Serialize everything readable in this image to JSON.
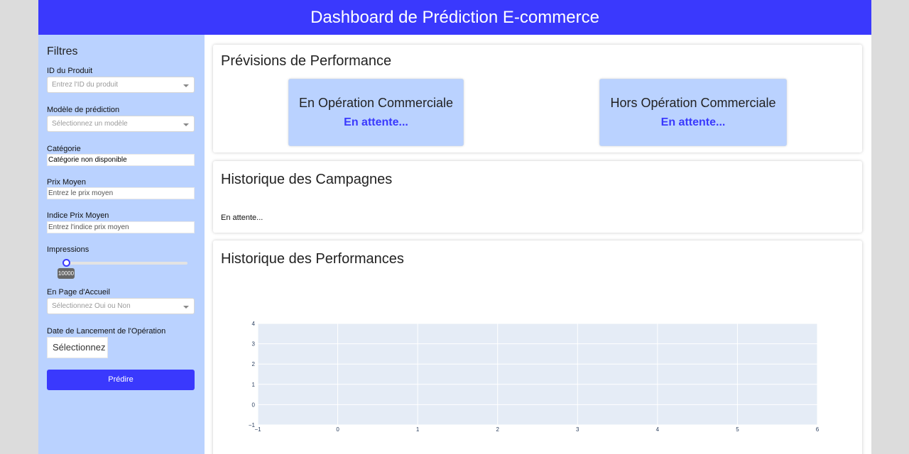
{
  "header": {
    "title": "Dashboard de Prédiction E-commerce"
  },
  "sidebar": {
    "title": "Filtres",
    "product_id": {
      "label": "ID du Produit",
      "placeholder": "Entrez l'ID du produit"
    },
    "model": {
      "label": "Modèle de prédiction",
      "placeholder": "Sélectionnez un modèle"
    },
    "category": {
      "label": "Catégorie",
      "value": "Catégorie non disponible"
    },
    "avg_price": {
      "label": "Prix Moyen",
      "placeholder": "Entrez le prix moyen"
    },
    "avg_price_index": {
      "label": "Indice Prix Moyen",
      "placeholder": "Entrez l'indice prix moyen"
    },
    "impressions": {
      "label": "Impressions",
      "value": "10000"
    },
    "homepage": {
      "label": "En Page d'Accueil",
      "placeholder": "Sélectionnez Oui ou Non"
    },
    "launch_date": {
      "label": "Date de Lancement de l'Opération",
      "placeholder": "Sélectionnez"
    },
    "predict_label": "Prédire"
  },
  "forecast": {
    "title": "Prévisions de Performance",
    "in_operation": {
      "title": "En Opération Commerciale",
      "value": "En attente..."
    },
    "out_operation": {
      "title": "Hors Opération Commerciale",
      "value": "En attente..."
    }
  },
  "campaigns": {
    "title": "Historique des Campagnes",
    "status": "En attente..."
  },
  "performance": {
    "title": "Historique des Performances"
  },
  "colors": {
    "accent": "#3a39fd",
    "sidebar_bg": "#bad2ff",
    "plot_bg": "#e5ecf6",
    "axis_text": "#2a3f5f"
  },
  "chart_data": {
    "type": "line",
    "series": [],
    "xlim": [
      -1,
      6
    ],
    "ylim": [
      -1,
      4
    ],
    "x_ticks": [
      "−1",
      "0",
      "1",
      "2",
      "3",
      "4",
      "5",
      "6"
    ],
    "y_ticks": [
      "−1",
      "0",
      "1",
      "2",
      "3",
      "4"
    ],
    "grid": true,
    "title": "",
    "xlabel": "",
    "ylabel": ""
  }
}
